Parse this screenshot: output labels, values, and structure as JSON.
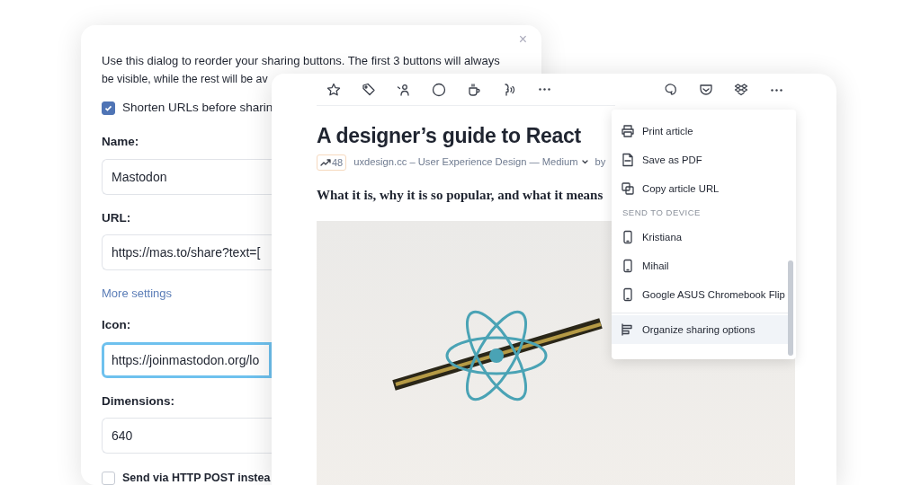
{
  "dialog": {
    "close": "×",
    "intro_lines": [
      "Use this dialog to reorder your sharing buttons. The first 3 buttons will always",
      "be visible, while the rest will be av"
    ],
    "items": [
      {
        "kind": "checkbox",
        "label": "Shorten URLs before sharin",
        "checked": true
      },
      {
        "kind": "field",
        "label": "Name:",
        "value": "Mastodon",
        "focused": false
      },
      {
        "kind": "field",
        "label": "URL:",
        "value": "https://mas.to/share?text=[",
        "focused": false
      },
      {
        "kind": "link",
        "label": "More settings"
      },
      {
        "kind": "field",
        "label": "Icon:",
        "value": "https://joinmastodon.org/lo",
        "focused": true
      },
      {
        "kind": "field",
        "label": "Dimensions:",
        "value": "640",
        "focused": false
      },
      {
        "kind": "checkbox",
        "label": "Send via HTTP POST instea",
        "checked": false
      }
    ]
  },
  "article": {
    "title": "A designer’s guide to React",
    "trend": "48",
    "source": "uxdesign.cc – User Experience Design — Medium",
    "byline": "by",
    "subtitle": "What it is, why it is so popular, and what it means"
  },
  "menu": {
    "items": [
      {
        "kind": "print",
        "label": "Print article",
        "selected": false
      },
      {
        "kind": "pdf",
        "label": "Save as PDF",
        "selected": false
      },
      {
        "kind": "copy",
        "label": "Copy article URL",
        "selected": false
      },
      {
        "kind": "header",
        "label": "SEND TO DEVICE"
      },
      {
        "kind": "device",
        "label": "Kristiana",
        "selected": false
      },
      {
        "kind": "device",
        "label": "Mihail",
        "selected": false
      },
      {
        "kind": "device",
        "label": "Google ASUS Chromebook Flip",
        "selected": false
      },
      {
        "kind": "organize",
        "label": "Organize sharing options",
        "selected": true
      }
    ]
  }
}
